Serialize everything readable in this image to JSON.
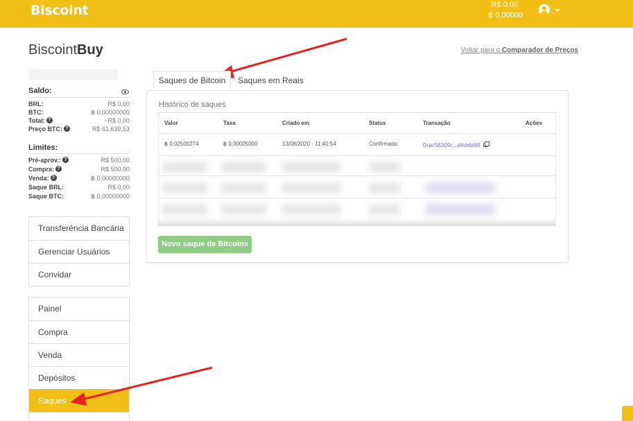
{
  "header": {
    "logo": "Biscoint",
    "balance_brl": "R$ 0,00",
    "balance_btc": "฿ 0,00000"
  },
  "page": {
    "brand_normal": "Biscoint",
    "brand_bold": "Buy",
    "back_link_prefix": "Voltar para o ",
    "back_link_bold": "Comparador de Preços"
  },
  "sidebar": {
    "saldo_title": "Saldo:",
    "saldo": [
      {
        "label": "BRL:",
        "value": "R$ 0,00"
      },
      {
        "label": "BTC:",
        "value": "฿ 0,00000000"
      },
      {
        "label": "Total:",
        "value": "~R$ 0,00"
      },
      {
        "label": "Preço BTC:",
        "value": "R$ 61.639,53"
      }
    ],
    "limites_title": "Limites:",
    "limites": [
      {
        "label": "Pré-aprov.:",
        "value": "R$ 500,00"
      },
      {
        "label": "Compra:",
        "value": "R$ 500,00"
      },
      {
        "label": "Venda:",
        "value": "฿ 0,00000000"
      },
      {
        "label": "Saque BRL:",
        "value": "R$ 0,00"
      },
      {
        "label": "Saque BTC:",
        "value": "฿ 0,00000000"
      }
    ],
    "menu1": [
      "Transferência Bancária",
      "Gerenciar Usuários",
      "Convidar"
    ],
    "menu2": [
      "Painel",
      "Compra",
      "Venda",
      "Depósitos",
      "Saques"
    ],
    "active_item": "Saques"
  },
  "tabs": [
    {
      "label": "Saques de Bitcoin",
      "active": true
    },
    {
      "label": "Saques em Reais",
      "active": false
    }
  ],
  "withdrawals": {
    "title": "Histórico de saques",
    "columns": [
      "Valor",
      "Taxa",
      "Criado em",
      "Status",
      "Transação",
      "Ações"
    ],
    "rows": [
      {
        "valor": "฿ 0,02500274",
        "taxa": "฿ 0,00005000",
        "criado_em": "13/08/2020 - 11:40:54",
        "status": "Confirmado",
        "transacao": "0xac56309c...d4debl86"
      }
    ],
    "new_button": "Novo saque de Bitcoins"
  },
  "colors": {
    "brand_yellow": "#f2bf16",
    "button_green": "#8fcc85",
    "link_purple": "#7b6fd6",
    "arrow_red": "#e8231f"
  },
  "icons": [
    "user-icon",
    "chevron-down-icon",
    "eye-icon",
    "help-icon",
    "copy-icon"
  ]
}
